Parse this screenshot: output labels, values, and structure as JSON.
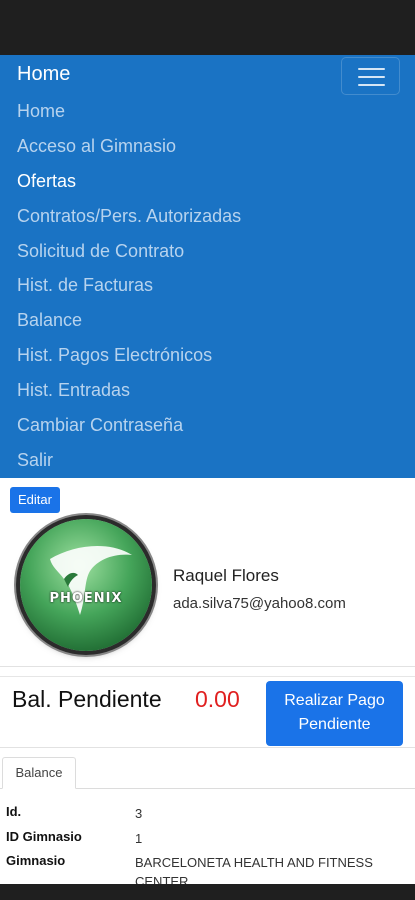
{
  "navbar": {
    "brand": "Home",
    "toggle_icon": "hamburger-menu-icon",
    "items": [
      {
        "label": "Home",
        "active": false
      },
      {
        "label": "Acceso al Gimnasio",
        "active": false
      },
      {
        "label": "Ofertas",
        "active": true
      },
      {
        "label": "Contratos/Pers. Autorizadas",
        "active": false
      },
      {
        "label": "Solicitud de Contrato",
        "active": false
      },
      {
        "label": "Hist. de Facturas",
        "active": false
      },
      {
        "label": "Balance",
        "active": false
      },
      {
        "label": "Hist. Pagos Electrónicos",
        "active": false
      },
      {
        "label": "Hist. Entradas",
        "active": false
      },
      {
        "label": "Cambiar Contraseña",
        "active": false
      },
      {
        "label": "Salir",
        "active": false
      }
    ]
  },
  "profile": {
    "edit_label": "Editar",
    "logo_text": "PHOENIX",
    "name": "Raquel Flores",
    "email": "ada.silva75@yahoo8.com"
  },
  "balance": {
    "label": "Bal. Pendiente",
    "value": "0.00",
    "pay_button_line1": "Realizar Pago",
    "pay_button_line2": "Pendiente"
  },
  "tabs": [
    {
      "label": "Balance"
    }
  ],
  "details": [
    {
      "key": "Id.",
      "value": "3"
    },
    {
      "key": "ID Gimnasio",
      "value": "1"
    },
    {
      "key": "Gimnasio",
      "value": "BARCELONETA HEALTH AND FITNESS CENTER"
    }
  ],
  "colors": {
    "navbar_bg": "#1a73c4",
    "primary_button": "#1a73e8",
    "balance_value": "#e02020"
  }
}
